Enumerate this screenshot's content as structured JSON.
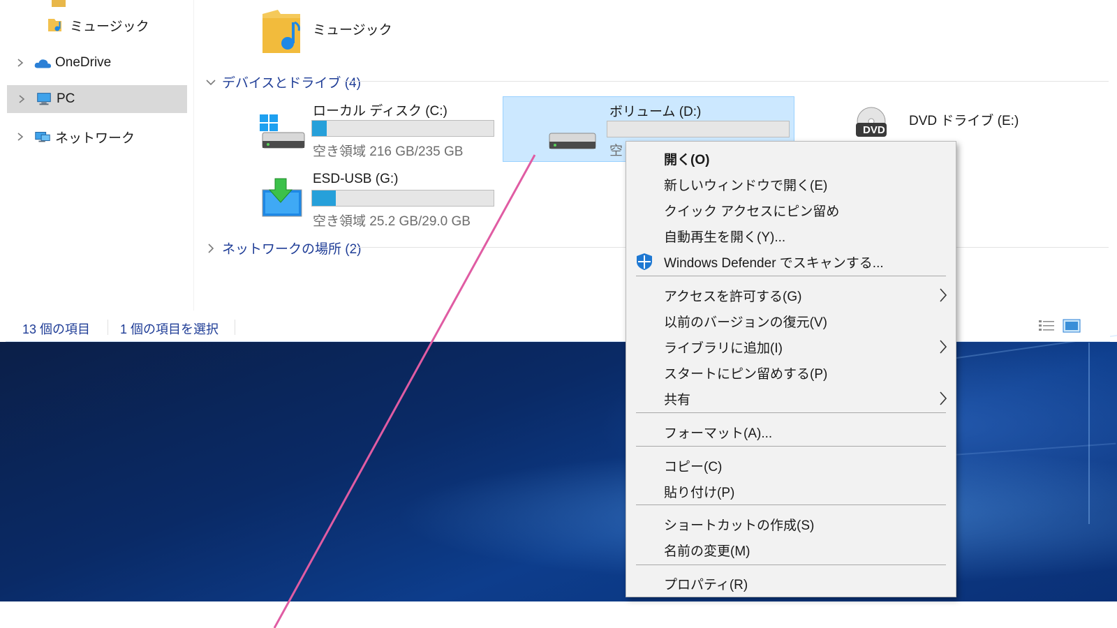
{
  "nav": {
    "items": [
      {
        "label": "ミュージック",
        "icon": "music-folder-icon"
      },
      {
        "label": "OneDrive",
        "icon": "cloud-icon"
      },
      {
        "label": "PC",
        "icon": "pc-icon"
      },
      {
        "label": "ネットワーク",
        "icon": "network-icon"
      }
    ]
  },
  "content": {
    "top_folder": {
      "label": "ミュージック",
      "icon": "music-folder-icon"
    },
    "groups": [
      {
        "label": "デバイスとドライブ (4)",
        "icon": "chevron-down-icon"
      },
      {
        "label": "ネットワークの場所 (2)",
        "icon": "chevron-right-icon"
      }
    ],
    "drives": [
      {
        "name": "ローカル ディスク (C:)",
        "free": "空き領域 216 GB/235 GB",
        "used_fraction": 0.08,
        "icon": "windows-drive-icon"
      },
      {
        "name": "ボリューム (D:)",
        "free": "空",
        "used_fraction": 0.0,
        "icon": "hard-drive-icon"
      },
      {
        "name": "DVD ドライブ (E:)",
        "badge": "DVD",
        "icon": "dvd-drive-icon"
      },
      {
        "name": "ESD-USB (G:)",
        "free": "空き領域 25.2 GB/29.0 GB",
        "used_fraction": 0.13,
        "icon": "usb-setup-drive-icon"
      }
    ]
  },
  "status": {
    "count": "13 個の項目",
    "selected": "1 個の項目を選択"
  },
  "context_menu": {
    "items": [
      {
        "label": "開く(O)",
        "bold": true
      },
      {
        "label": "新しいウィンドウで開く(E)"
      },
      {
        "label": "クイック アクセスにピン留め"
      },
      {
        "label": "自動再生を開く(Y)..."
      },
      {
        "label": "Windows Defender でスキャンする...",
        "icon": "shield-icon"
      },
      {
        "label": "アクセスを許可する(G)",
        "submenu": true
      },
      {
        "label": "以前のバージョンの復元(V)"
      },
      {
        "label": "ライブラリに追加(I)",
        "submenu": true
      },
      {
        "label": "スタートにピン留めする(P)"
      },
      {
        "label": "共有",
        "submenu": true
      },
      {
        "label": "フォーマット(A)..."
      },
      {
        "label": "コピー(C)"
      },
      {
        "label": "貼り付け(P)"
      },
      {
        "label": "ショートカットの作成(S)"
      },
      {
        "label": "名前の変更(M)"
      },
      {
        "label": "プロパティ(R)"
      }
    ]
  },
  "colors": {
    "accent": "#26a0da",
    "link_blue": "#1e3c96",
    "selection": "#cce8ff",
    "pointer_line": "#e05ca3"
  }
}
